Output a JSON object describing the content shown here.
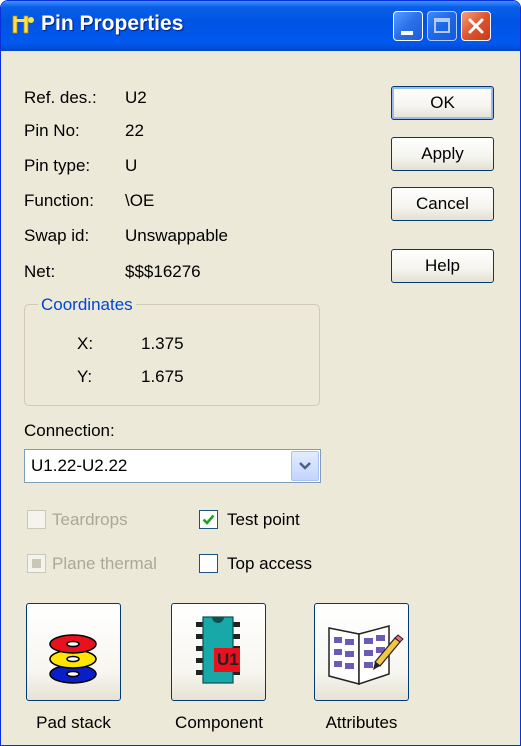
{
  "window": {
    "title": "Pin Properties"
  },
  "fields": {
    "refdes": {
      "label": "Ref. des.:",
      "value": "U2"
    },
    "pin_no": {
      "label": "Pin No:",
      "value": "22"
    },
    "pin_type": {
      "label": "Pin type:",
      "value": "U"
    },
    "function": {
      "label": "Function:",
      "value": "\\OE"
    },
    "swap_id": {
      "label": "Swap id:",
      "value": "Unswappable"
    },
    "net": {
      "label": "Net:",
      "value": "$$$16276"
    }
  },
  "coordinates": {
    "title": "Coordinates",
    "x_label": "X:",
    "x_value": "1.375",
    "y_label": "Y:",
    "y_value": "1.675"
  },
  "buttons": {
    "ok": "OK",
    "apply": "Apply",
    "cancel": "Cancel",
    "help": "Help"
  },
  "connection": {
    "label": "Connection:",
    "selected": "U1.22-U2.22"
  },
  "options": {
    "teardrops": {
      "label": "Teardrops",
      "checked": false,
      "enabled": false
    },
    "test_point": {
      "label": "Test point",
      "checked": true,
      "enabled": true
    },
    "plane_thermal": {
      "label": "Plane thermal",
      "checked": "indeterminate",
      "enabled": false
    },
    "top_access": {
      "label": "Top access",
      "checked": false,
      "enabled": true
    }
  },
  "tiles": {
    "pad_stack": "Pad stack",
    "component": "Component",
    "attributes": "Attributes",
    "component_badge": "U1"
  },
  "colors": {
    "title_bar": "#0054e3",
    "group_title": "#0046d5",
    "disabled_text": "#aca899"
  }
}
